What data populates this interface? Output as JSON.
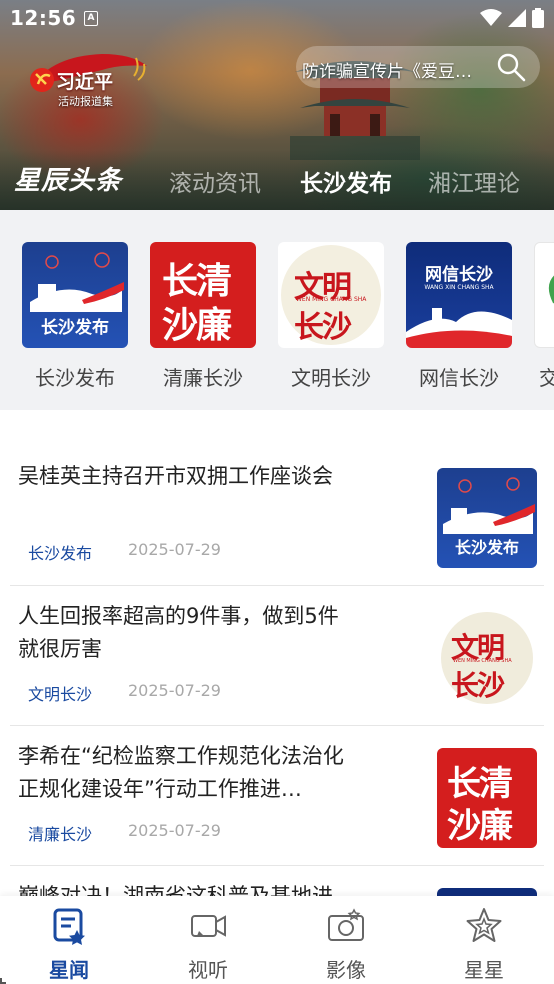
{
  "status_bar": {
    "time": "12:56",
    "notification_icon": "A"
  },
  "header": {
    "logo_title": "习近平",
    "logo_subtitle": "活动报道集",
    "search_placeholder": "防诈骗宣传片《爱豆…",
    "tabs": [
      {
        "label": "星辰头条",
        "state": "brand"
      },
      {
        "label": "滚动资讯",
        "state": "inactive"
      },
      {
        "label": "长沙发布",
        "state": "active"
      },
      {
        "label": "湘江理论",
        "state": "inactive"
      }
    ]
  },
  "channels": [
    {
      "label": "长沙发布",
      "icon": "changsha-fabu-logo",
      "logo_text": "长沙发布"
    },
    {
      "label": "清廉长沙",
      "icon": "qinglian-changsha-logo",
      "logo_text_1": "长清",
      "logo_text_2": "沙廉"
    },
    {
      "label": "文明长沙",
      "icon": "wenming-changsha-logo",
      "logo_text_1": "文明",
      "logo_text_2": "长沙",
      "logo_pinyin": "WEN MING CHANG SHA"
    },
    {
      "label": "网信长沙",
      "icon": "wangxin-changsha-logo",
      "logo_text": "网信长沙",
      "logo_pinyin": "WANG XIN CHANG SHA"
    },
    {
      "label": "交",
      "icon": "partial-channel-logo"
    }
  ],
  "news": [
    {
      "title": "吴桂英主持召开市双拥工作座谈会",
      "source": "长沙发布",
      "date": "2025-07-29",
      "thumb": "changsha-fabu-logo"
    },
    {
      "title": "人生回报率超高的9件事，做到5件就很厉害",
      "source": "文明长沙",
      "date": "2025-07-29",
      "thumb": "wenming-changsha-logo"
    },
    {
      "title": "李希在“纪检监察工作规范化法治化正规化建设年”行动工作推进…",
      "source": "清廉长沙",
      "date": "2025-07-29",
      "thumb": "qinglian-changsha-logo"
    },
    {
      "title": "巅峰对决！湖南省这科普及基地进",
      "source": "",
      "date": "",
      "thumb": "changsha-fabu-logo"
    }
  ],
  "bottom_nav": [
    {
      "label": "星闻",
      "icon": "news-doc-icon",
      "active": true
    },
    {
      "label": "视听",
      "icon": "video-camera-icon",
      "active": false
    },
    {
      "label": "影像",
      "icon": "camera-icon",
      "active": false
    },
    {
      "label": "星星",
      "icon": "star-icon",
      "active": false
    }
  ],
  "colors": {
    "accent": "#1a4aa0",
    "brand_red": "#d41e1e",
    "tile_blue": "#2452b5"
  }
}
